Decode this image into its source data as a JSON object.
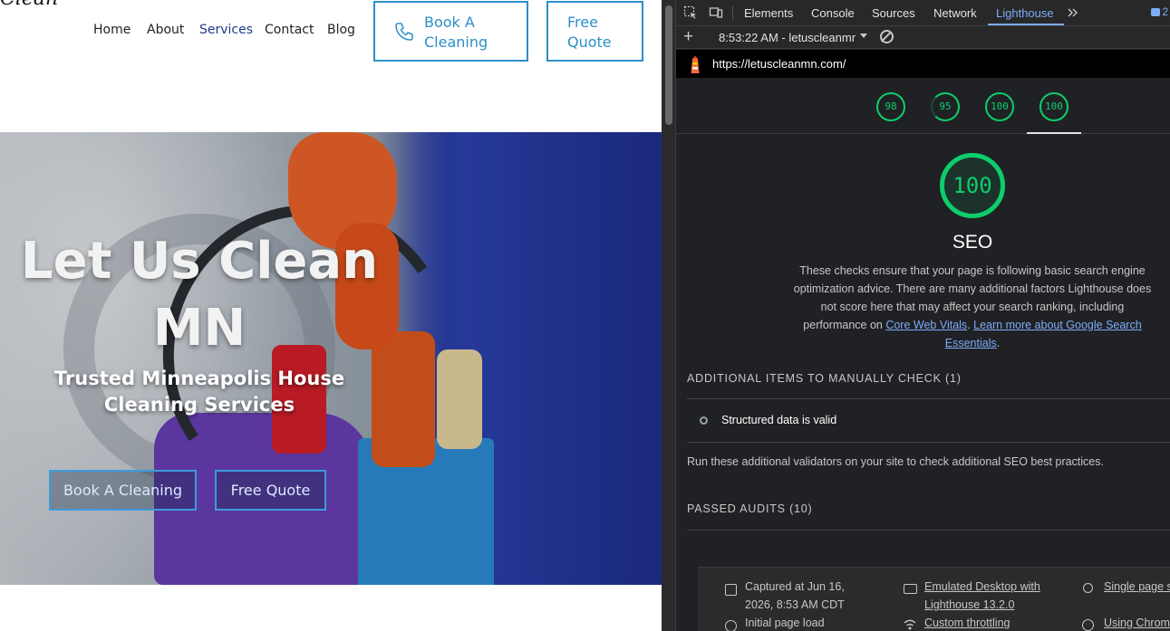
{
  "site": {
    "logo_fragment": "Clean",
    "nav": [
      "Home",
      "About",
      "Services",
      "Contact",
      "Blog"
    ],
    "active_nav": "Services",
    "book_button": "Book A Cleaning",
    "quote_button": "Free Quote",
    "hero": {
      "title": "Let Us Clean MN",
      "subtitle": "Trusted Minneapolis House Cleaning Services",
      "cta_book": "Book A Cleaning",
      "cta_quote": "Free Quote"
    },
    "accent_color": "#2d8fc9"
  },
  "devtools": {
    "tabs": [
      "Elements",
      "Console",
      "Sources",
      "Network",
      "Lighthouse"
    ],
    "active_tab": "Lighthouse",
    "issues_count": "2",
    "report_label": "8:53:22 AM - letuscleanmr",
    "url": "https://letuscleanmn.com/",
    "scores": [
      {
        "value": "98"
      },
      {
        "value": "95"
      },
      {
        "value": "100"
      },
      {
        "value": "100"
      }
    ],
    "score_color": "#0cce6b",
    "category": {
      "score": "100",
      "title": "SEO",
      "description_pre": "These checks ensure that your page is following basic search engine optimization advice. There are many additional factors Lighthouse does not score here that may affect your search ranking, including performance on ",
      "link1": "Core Web Vitals",
      "description_mid": ". ",
      "link2": "Learn more about Google Search Essentials",
      "description_post": "."
    },
    "manual_header": "ADDITIONAL ITEMS TO MANUALLY CHECK (1)",
    "manual_item": "Structured data is valid",
    "manual_note": "Run these additional validators on your site to check additional SEO best practices.",
    "passed_header": "PASSED AUDITS (10)",
    "footer": {
      "captured": "Captured at Jun 16, 2026, 8:53 AM CDT",
      "initial_load": "Initial page load",
      "emulated": "Emulated Desktop with Lighthouse 13.2.0",
      "throttling": "Custom throttling",
      "single_page": "Single page s",
      "using_chrome": "Using Chrom"
    }
  }
}
